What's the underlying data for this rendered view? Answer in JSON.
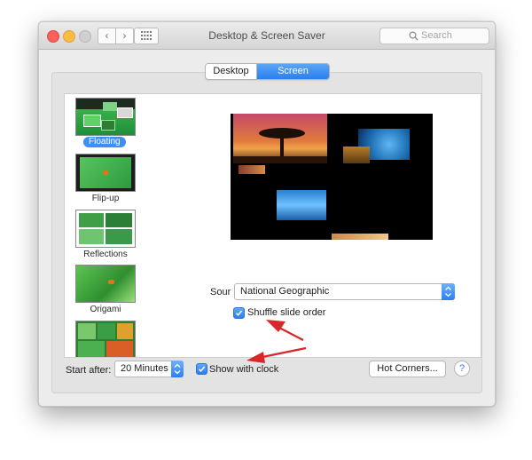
{
  "window": {
    "title": "Desktop & Screen Saver",
    "search_placeholder": "Search",
    "nav_back_icon": "chevron-left-icon",
    "nav_forward_icon": "chevron-right-icon"
  },
  "tabs": [
    {
      "label": "Desktop",
      "selected": false
    },
    {
      "label": "Screen Saver",
      "selected": true
    }
  ],
  "screen_savers": [
    {
      "label": "Floating",
      "selected": true
    },
    {
      "label": "Flip-up",
      "selected": false
    },
    {
      "label": "Reflections",
      "selected": false
    },
    {
      "label": "Origami",
      "selected": false
    },
    {
      "label": "",
      "selected": false
    }
  ],
  "options": {
    "source_label": "Sour",
    "source_value": "National Geographic",
    "shuffle_label": "Shuffle slide order",
    "shuffle_checked": true
  },
  "bottom": {
    "start_after_label": "Start after:",
    "start_after_value": "20 Minutes",
    "show_clock_label": "Show with clock",
    "show_clock_checked": true,
    "hot_corners_label": "Hot Corners...",
    "help_label": "?"
  },
  "colors": {
    "accent": "#2b7ef0",
    "annotation_arrow": "#d8262a"
  }
}
